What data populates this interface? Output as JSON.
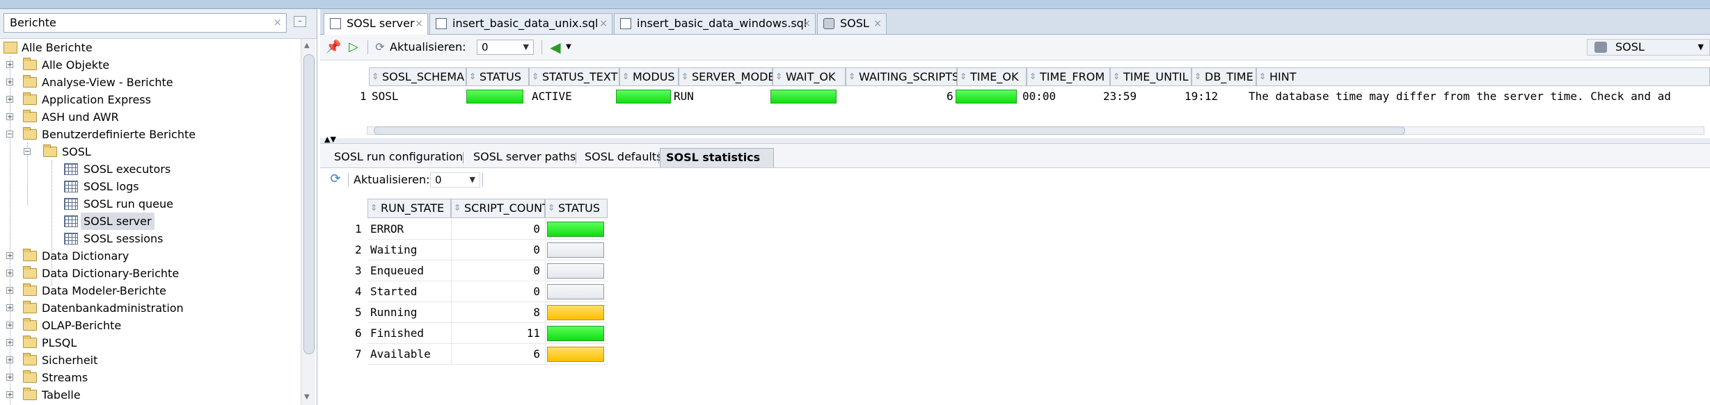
{
  "left_panel": {
    "title": "Berichte",
    "close": "×",
    "minimize": "–",
    "tree": [
      {
        "label": "Alle Berichte",
        "icon": "reports-root-icon",
        "level": "root"
      },
      {
        "label": "Alle Objekte",
        "toggle": "+",
        "icon": "folder-icon"
      },
      {
        "label": "Analyse-View - Berichte",
        "toggle": "+",
        "icon": "folder-icon"
      },
      {
        "label": "Application Express",
        "toggle": "+",
        "icon": "folder-icon"
      },
      {
        "label": "ASH und AWR",
        "toggle": "+",
        "icon": "folder-icon"
      },
      {
        "label": "Benutzerdefinierte Berichte",
        "toggle": "−",
        "icon": "folder-icon"
      },
      {
        "label": "SOSL",
        "toggle": "−",
        "icon": "folder-icon"
      },
      {
        "label": "SOSL executors",
        "icon": "report-grid-icon"
      },
      {
        "label": "SOSL logs",
        "icon": "report-grid-icon"
      },
      {
        "label": "SOSL run queue",
        "icon": "report-grid-icon"
      },
      {
        "label": "SOSL server",
        "icon": "report-grid-icon",
        "selected": true
      },
      {
        "label": "SOSL sessions",
        "icon": "report-grid-icon"
      },
      {
        "label": "Data Dictionary",
        "toggle": "+",
        "icon": "folder-icon"
      },
      {
        "label": "Data Dictionary-Berichte",
        "toggle": "+",
        "icon": "folder-icon"
      },
      {
        "label": "Data Modeler-Berichte",
        "toggle": "+",
        "icon": "folder-icon"
      },
      {
        "label": "Datenbankadministration",
        "toggle": "+",
        "icon": "folder-icon"
      },
      {
        "label": "OLAP-Berichte",
        "toggle": "+",
        "icon": "folder-icon"
      },
      {
        "label": "PLSQL",
        "toggle": "+",
        "icon": "folder-icon"
      },
      {
        "label": "Sicherheit",
        "toggle": "+",
        "icon": "folder-icon"
      },
      {
        "label": "Streams",
        "toggle": "+",
        "icon": "folder-icon"
      },
      {
        "label": "Tabelle",
        "toggle": "+",
        "icon": "folder-icon"
      }
    ]
  },
  "editor_tabs": [
    {
      "label": "SOSL server",
      "icon": "report-grid-icon",
      "active": true
    },
    {
      "label": "insert_basic_data_unix.sql",
      "icon": "sql-file-icon"
    },
    {
      "label": "insert_basic_data_windows.sql",
      "icon": "sql-file-icon"
    },
    {
      "label": "SOSL",
      "icon": "database-icon"
    }
  ],
  "tab_close": "×",
  "toolbar": {
    "refresh_label": "Aktualisieren:",
    "refresh_value": "0",
    "connection": "SOSL",
    "pin_icon": "pin-icon",
    "run_icon": "run-icon",
    "back_icon": "back-arrow-icon"
  },
  "upper_grid": {
    "columns": [
      "SOSL_SCHEMA",
      "STATUS",
      "STATUS_TEXT",
      "MODUS",
      "SERVER_MODE",
      "WAIT_OK",
      "WAITING_SCRIPTS",
      "TIME_OK",
      "TIME_FROM",
      "TIME_UNTIL",
      "DB_TIME",
      "HINT"
    ],
    "row": {
      "num": "1",
      "SOSL_SCHEMA": "SOSL",
      "STATUS": "green",
      "STATUS_TEXT": "ACTIVE",
      "MODUS": "green",
      "SERVER_MODE": "RUN",
      "WAIT_OK": "green",
      "WAITING_SCRIPTS": "6",
      "TIME_OK": "green",
      "TIME_FROM": "00:00",
      "TIME_UNTIL": "23:59",
      "DB_TIME": "19:12",
      "HINT": "The database time may differ from the server time. Check and ad"
    }
  },
  "sub_tabs": [
    {
      "label": "SOSL run configuration"
    },
    {
      "label": "SOSL server paths"
    },
    {
      "label": "SOSL defaults"
    },
    {
      "label": "SOSL statistics",
      "active": true
    }
  ],
  "sub_toolbar": {
    "refresh_label": "Aktualisieren:",
    "refresh_value": "0"
  },
  "stats_grid": {
    "columns": [
      "RUN_STATE",
      "SCRIPT_COUNT",
      "STATUS"
    ],
    "rows": [
      {
        "num": "1",
        "run_state": "ERROR",
        "count": "0",
        "status": "green"
      },
      {
        "num": "2",
        "run_state": "Waiting",
        "count": "0",
        "status": "empty"
      },
      {
        "num": "3",
        "run_state": "Enqueued",
        "count": "0",
        "status": "empty"
      },
      {
        "num": "4",
        "run_state": "Started",
        "count": "0",
        "status": "empty"
      },
      {
        "num": "5",
        "run_state": "Running",
        "count": "8",
        "status": "yellow"
      },
      {
        "num": "6",
        "run_state": "Finished",
        "count": "11",
        "status": "green"
      },
      {
        "num": "7",
        "run_state": "Available",
        "count": "6",
        "status": "yellow"
      }
    ]
  }
}
